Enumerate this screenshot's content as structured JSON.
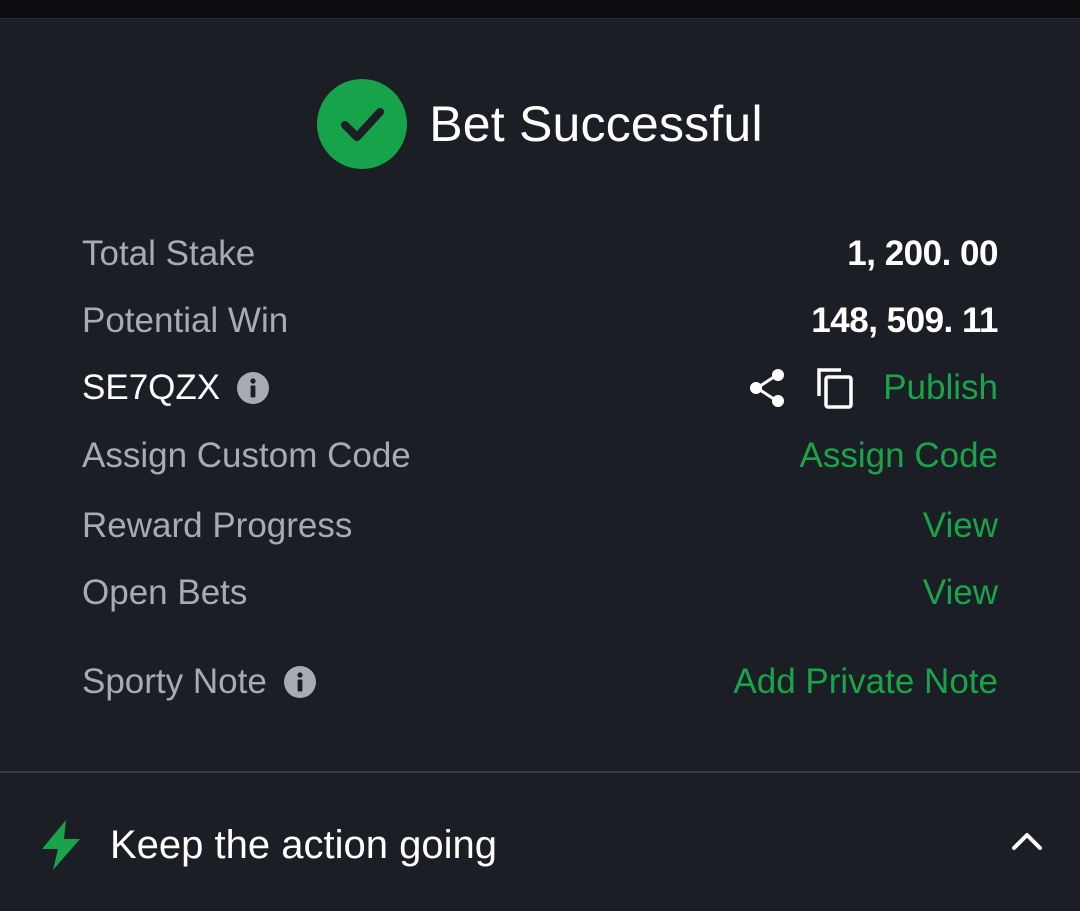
{
  "header": {
    "title": "Bet Successful"
  },
  "summary": {
    "total_stake_label": "Total Stake",
    "total_stake_value": "1, 200. 00",
    "potential_win_label": "Potential Win",
    "potential_win_value": "148, 509. 11"
  },
  "booking": {
    "code": "SE7QZX",
    "publish_label": "Publish"
  },
  "rows": {
    "custom_code_label": "Assign Custom Code",
    "custom_code_action": "Assign Code",
    "reward_label": "Reward Progress",
    "reward_action": "View",
    "open_bets_label": "Open Bets",
    "open_bets_action": "View",
    "note_label": "Sporty Note",
    "note_action": "Add Private Note"
  },
  "footer": {
    "title": "Keep the action going"
  },
  "colors": {
    "accent": "#1aa44a",
    "background": "#1b1e24",
    "success": "#16a34a"
  }
}
